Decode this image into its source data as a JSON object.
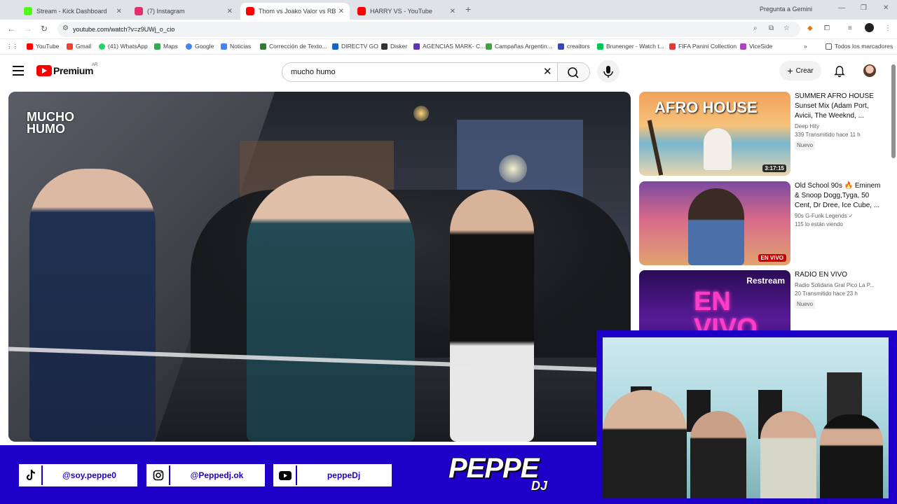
{
  "browser": {
    "tabs": [
      {
        "title": "Stream - Kick Dashboard",
        "color": "#53fc18",
        "active": false
      },
      {
        "title": "(7) Instagram",
        "color": "#e1306c",
        "active": false
      },
      {
        "title": "Thom vs Joako Valor vs RBG vs",
        "color": "#ff0000",
        "active": true
      },
      {
        "title": "HARRY VS - YouTube",
        "color": "#ff0000",
        "active": false
      }
    ],
    "new_tab": "+",
    "gemini": "Pregunta a Gemini",
    "url": "youtube.com/watch?v=z9UWj_o_cio",
    "bookmarks": [
      {
        "label": "YouTube",
        "color": "#ff0000"
      },
      {
        "label": "Gmail",
        "color": "#ea4335"
      },
      {
        "label": "(41) WhatsApp",
        "color": "#25d366"
      },
      {
        "label": "Maps",
        "color": "#34a853"
      },
      {
        "label": "Google",
        "color": "#4285f4"
      },
      {
        "label": "Noticias",
        "color": "#4285f4"
      },
      {
        "label": "Corrección de Texto...",
        "color": "#2e7d32"
      },
      {
        "label": "DIRECTV GO",
        "color": "#1565c0"
      },
      {
        "label": "Disker",
        "color": "#333333"
      },
      {
        "label": "AGENCIAS MARK- C...",
        "color": "#5e35b1"
      },
      {
        "label": "Campañas Argentin...",
        "color": "#43a047"
      },
      {
        "label": "creaitors",
        "color": "#3949ab"
      },
      {
        "label": "Brunenger - Watch t...",
        "color": "#00c853"
      },
      {
        "label": "FIFA Panini Collection",
        "color": "#e53935"
      },
      {
        "label": "ViceSide",
        "color": "#ab47bc"
      }
    ],
    "more_bookmarks": "»",
    "all_bookmarks": "Todos los marcadores"
  },
  "youtube": {
    "brand": "Premium",
    "region": "AR",
    "search_value": "mucho humo",
    "create_label": "Crear",
    "plus": "+"
  },
  "video": {
    "logo_line1": "MUCHO",
    "logo_line2": "HUMO"
  },
  "sidebar": [
    {
      "title": "SUMMER AFRO HOUSE Sunset Mix (Adam Port, Avicii, The Weeknd, ...",
      "channel": "Deep Hity",
      "stats": "339  Transmitido hace 11 h",
      "badge": "Nuevo",
      "thumb_text": "AFRO HOUSE",
      "duration": "3:17:15"
    },
    {
      "title": "Old School 90s 🔥 Eminem & Snoop Dogg,Tyga, 50 Cent, Dr Dree, Ice Cube, ...",
      "channel": "90s G-Funk Legends ✓",
      "stats": "115 lo están viendo",
      "live_badge": "EN VIVO"
    },
    {
      "title": "RADIO EN VIVO",
      "channel": "Radio Solidaria Gral Pico La P...",
      "stats": "20  Transmitido hace 23 h",
      "badge": "Nuevo",
      "thumb_text": "Restream",
      "thumb_big": "EN VIVO"
    }
  ],
  "overlay": {
    "tiktok": "@soy.peppe0",
    "instagram": "@Peppedj.ok",
    "youtube": "peppeDj",
    "brand": "PEPPE",
    "brand_sub": "DJ",
    "bar_color": "#1e00c8"
  }
}
